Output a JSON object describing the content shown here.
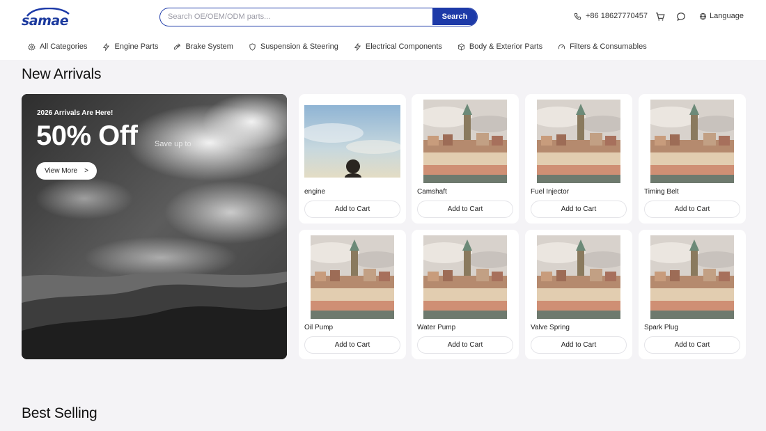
{
  "header": {
    "logo_text": "samae",
    "search": {
      "placeholder": "Search OE/OEM/ODM parts...",
      "value": "",
      "button_label": "Search"
    },
    "phone": "+86 18627770457",
    "language_label": "Language"
  },
  "nav": {
    "items": [
      {
        "label": "All Categories",
        "icon": "grid-gear-icon"
      },
      {
        "label": "Engine Parts",
        "icon": "bolt-icon"
      },
      {
        "label": "Brake System",
        "icon": "wrench-icon"
      },
      {
        "label": "Suspension & Steering",
        "icon": "shield-icon"
      },
      {
        "label": "Electrical Components",
        "icon": "bolt-icon"
      },
      {
        "label": "Body & Exterior Parts",
        "icon": "box-icon"
      },
      {
        "label": "Filters & Consumables",
        "icon": "gauge-icon"
      }
    ]
  },
  "sections": {
    "new_arrivals": "New Arrivals",
    "best_selling": "Best Selling"
  },
  "banner": {
    "subtitle": "2026 Arrivals Are Here!",
    "headline": "50% Off",
    "save_text": "Save up to",
    "button_label": "View More",
    "button_arrow": ">"
  },
  "products": [
    {
      "name": "engine",
      "button": "Add to Cart",
      "image": "sky-person"
    },
    {
      "name": "Camshaft",
      "button": "Add to Cart",
      "image": "city"
    },
    {
      "name": "Fuel Injector",
      "button": "Add to Cart",
      "image": "city"
    },
    {
      "name": "Timing Belt",
      "button": "Add to Cart",
      "image": "city"
    },
    {
      "name": "Oil Pump",
      "button": "Add to Cart",
      "image": "city"
    },
    {
      "name": "Water Pump",
      "button": "Add to Cart",
      "image": "city"
    },
    {
      "name": "Valve Spring",
      "button": "Add to Cart",
      "image": "city"
    },
    {
      "name": "Spark Plug",
      "button": "Add to Cart",
      "image": "city"
    }
  ],
  "colors": {
    "brand": "#1d3aa8",
    "page_bg": "#f4f3f6",
    "card_bg": "#ffffff"
  }
}
